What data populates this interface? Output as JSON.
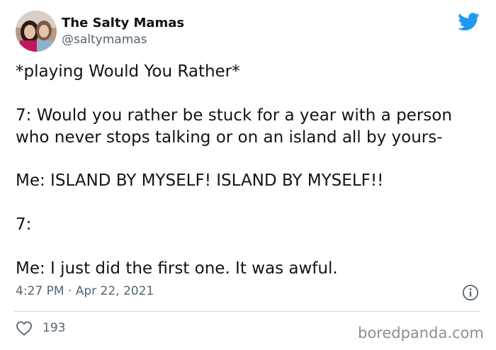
{
  "author": {
    "display_name": "The Salty Mamas",
    "handle": "@saltymamas",
    "avatar": "two-women-photo"
  },
  "brand": {
    "logo": "twitter-bird-icon",
    "color": "#1d9bf0"
  },
  "tweet": {
    "lines": [
      "*playing Would You Rather*",
      "7: Would you rather be stuck for a year with a person who never stops talking or on an island all by yours-",
      "Me: ISLAND BY MYSELF! ISLAND BY MYSELF!!",
      "7:",
      "Me: I just did the first one. It was awful."
    ],
    "timestamp": "4:27 PM · Apr 22, 2021"
  },
  "actions": {
    "like_icon": "heart-icon",
    "like_count": "193",
    "info_icon": "info-icon"
  },
  "watermark": "boredpanda.com"
}
